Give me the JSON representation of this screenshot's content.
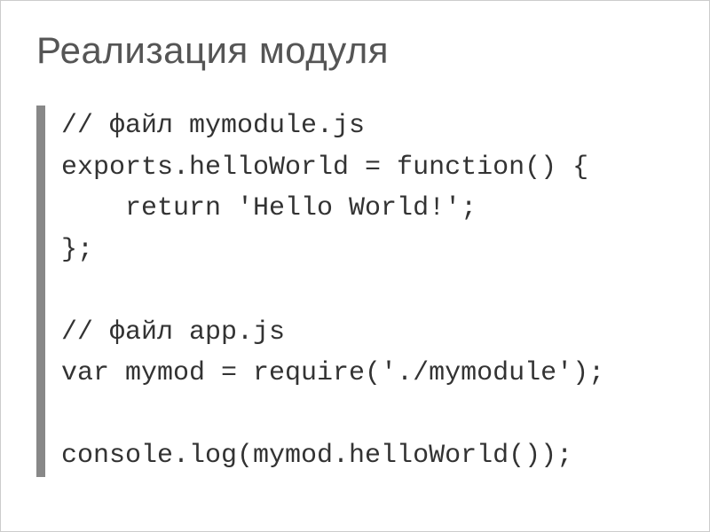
{
  "title": "Реализация модуля",
  "code": {
    "line1": "// файл mymodule.js",
    "line2": "exports.helloWorld = function() {",
    "line3": "    return 'Hello World!';",
    "line4": "};",
    "line5": "",
    "line6": "// файл app.js",
    "line7": "var mymod = require('./mymodule');",
    "line8": "",
    "line9": "console.log(mymod.helloWorld());"
  }
}
